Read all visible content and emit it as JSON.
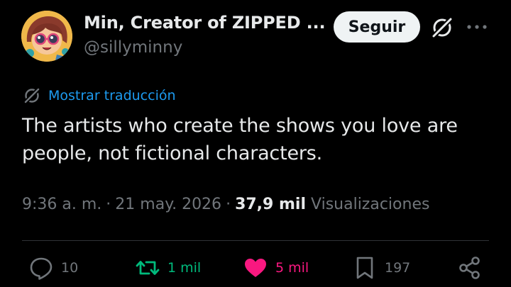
{
  "author": {
    "name": "Min, Creator of ZIPPED ...",
    "handle": "@sillyminny"
  },
  "header": {
    "follow_label": "Seguir",
    "grok_icon": "grok-icon",
    "more_icon": "more-dots-icon"
  },
  "translate": {
    "icon": "grok-icon",
    "label": "Mostrar traducción"
  },
  "tweet": {
    "text": "The artists who create the shows you love are people, not fictional characters."
  },
  "meta": {
    "time": "9:36 a. m.",
    "date": "21 may. 2026",
    "views_count": "37,9 mil",
    "views_label": "Visualizaciones",
    "separator": "·"
  },
  "actions": {
    "reply": {
      "icon": "reply-icon",
      "count": "10"
    },
    "retweet": {
      "icon": "retweet-icon",
      "count": "1 mil"
    },
    "like": {
      "icon": "heart-icon",
      "count": "5 mil",
      "liked": true
    },
    "bookmark": {
      "icon": "bookmark-icon",
      "count": "197"
    },
    "share": {
      "icon": "share-icon"
    }
  },
  "colors": {
    "background": "#000000",
    "text_primary": "#e7e9ea",
    "text_secondary": "#71767b",
    "link_blue": "#1d9bf0",
    "retweet_green": "#00ba7c",
    "like_pink": "#f91880",
    "follow_button_bg": "#eff3f4",
    "divider": "#2f3336"
  }
}
